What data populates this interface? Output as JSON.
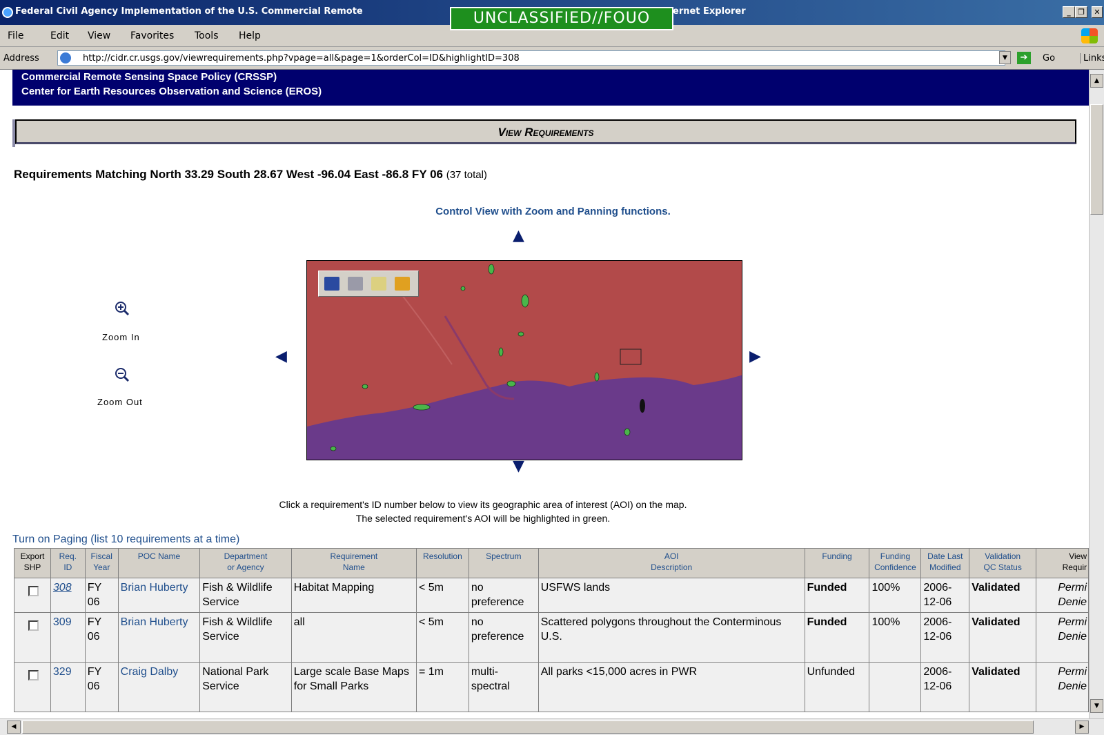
{
  "window": {
    "title": "Federal Civil Agency Implementation of the U.S. Commercial Remote",
    "title_suffix": "ernet Explorer",
    "classification": "UNCLASSIFIED//FOUO",
    "controls": {
      "minimize": "_",
      "maximize": "❐",
      "close": "✕"
    }
  },
  "menu": [
    "File",
    "Edit",
    "View",
    "Favorites",
    "Tools",
    "Help"
  ],
  "address": {
    "label": "Address",
    "url": "http://cidr.cr.usgs.gov/viewrequirements.php?vpage=all&page=1&orderCol=ID&highlightID=308",
    "go": "Go",
    "links": "Links"
  },
  "banner": {
    "line1": "Commercial Remote Sensing Space Policy (CRSSP)",
    "line2": "Center for Earth Resources Observation and Science (EROS)"
  },
  "page": {
    "heading": "View Requirements",
    "match_text": "Requirements Matching North 33.29 South 28.67 West -96.04 East -86.8 FY 06",
    "match_total": "(37 total)",
    "control_view": "Control View with Zoom and Panning functions.",
    "zoom_in": "Zoom In",
    "zoom_out": "Zoom Out",
    "instruction1": "Click a requirement's ID number below to view its geographic area of interest (AOI) on the map.",
    "instruction2": "The selected requirement's AOI will be highlighted in green.",
    "paging_link": "Turn on Paging (list 10 requirements at a time)"
  },
  "map": {
    "land_color": "#b24a4a",
    "water_color": "#6a3a8a",
    "highlight_color": "#4ab64a",
    "toolbar_icons": [
      "save-icon",
      "print-icon",
      "email-icon",
      "export-icon"
    ]
  },
  "table": {
    "headers": [
      {
        "l1": "Export",
        "l2": "SHP"
      },
      {
        "l1": "Req.",
        "l2": "ID"
      },
      {
        "l1": "Fiscal",
        "l2": "Year"
      },
      {
        "l1": "POC Name",
        "l2": ""
      },
      {
        "l1": "Department",
        "l2": "or Agency"
      },
      {
        "l1": "Requirement",
        "l2": "Name"
      },
      {
        "l1": "Resolution",
        "l2": ""
      },
      {
        "l1": "Spectrum",
        "l2": ""
      },
      {
        "l1": "AOI",
        "l2": "Description"
      },
      {
        "l1": "Funding",
        "l2": ""
      },
      {
        "l1": "Funding",
        "l2": "Confidence"
      },
      {
        "l1": "Date Last",
        "l2": "Modified"
      },
      {
        "l1": "Validation",
        "l2": "QC Status"
      },
      {
        "l1": "View",
        "l2": "Requir"
      }
    ],
    "rows": [
      {
        "id": "308",
        "fy": "FY 06",
        "poc": "Brian Huberty",
        "dept": "Fish & Wildlife Service",
        "name": "Habitat Mapping",
        "res": "< 5m",
        "spectrum": "no preference",
        "aoi": "USFWS lands",
        "funding": "Funded",
        "conf": "100%",
        "date": "2006-12-06",
        "status": "Validated",
        "view": "Permi Denie"
      },
      {
        "id": "309",
        "fy": "FY 06",
        "poc": "Brian Huberty",
        "dept": "Fish & Wildlife Service",
        "name": "all",
        "res": "< 5m",
        "spectrum": "no preference",
        "aoi": "Scattered polygons throughout the Conterminous U.S.",
        "funding": "Funded",
        "conf": "100%",
        "date": "2006-12-06",
        "status": "Validated",
        "view": "Permi Denie"
      },
      {
        "id": "329",
        "fy": "FY 06",
        "poc": "Craig Dalby",
        "dept": "National Park Service",
        "name": "Large scale Base Maps for Small Parks",
        "res": "= 1m",
        "spectrum": "multi-spectral",
        "aoi": "All parks <15,000 acres in PWR",
        "funding": "Unfunded",
        "conf": "",
        "date": "2006-12-06",
        "status": "Validated",
        "view": "Permi Denie"
      }
    ]
  }
}
